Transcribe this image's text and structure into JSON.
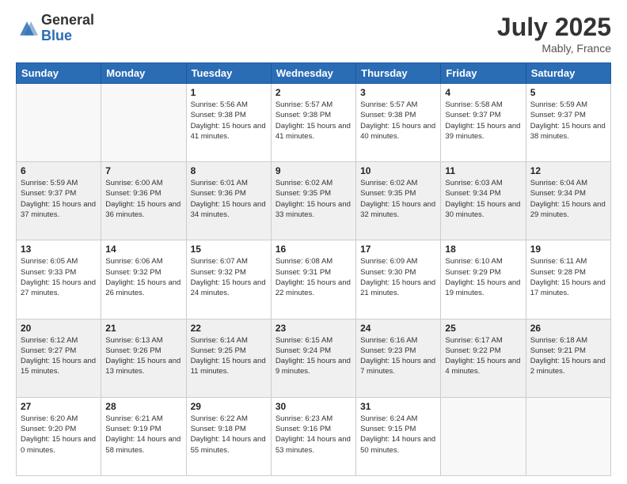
{
  "logo": {
    "general": "General",
    "blue": "Blue"
  },
  "title": {
    "month": "July 2025",
    "location": "Mably, France"
  },
  "days_of_week": [
    "Sunday",
    "Monday",
    "Tuesday",
    "Wednesday",
    "Thursday",
    "Friday",
    "Saturday"
  ],
  "weeks": [
    [
      {
        "day": "",
        "info": ""
      },
      {
        "day": "",
        "info": ""
      },
      {
        "day": "1",
        "info": "Sunrise: 5:56 AM\nSunset: 9:38 PM\nDaylight: 15 hours and 41 minutes."
      },
      {
        "day": "2",
        "info": "Sunrise: 5:57 AM\nSunset: 9:38 PM\nDaylight: 15 hours and 41 minutes."
      },
      {
        "day": "3",
        "info": "Sunrise: 5:57 AM\nSunset: 9:38 PM\nDaylight: 15 hours and 40 minutes."
      },
      {
        "day": "4",
        "info": "Sunrise: 5:58 AM\nSunset: 9:37 PM\nDaylight: 15 hours and 39 minutes."
      },
      {
        "day": "5",
        "info": "Sunrise: 5:59 AM\nSunset: 9:37 PM\nDaylight: 15 hours and 38 minutes."
      }
    ],
    [
      {
        "day": "6",
        "info": "Sunrise: 5:59 AM\nSunset: 9:37 PM\nDaylight: 15 hours and 37 minutes."
      },
      {
        "day": "7",
        "info": "Sunrise: 6:00 AM\nSunset: 9:36 PM\nDaylight: 15 hours and 36 minutes."
      },
      {
        "day": "8",
        "info": "Sunrise: 6:01 AM\nSunset: 9:36 PM\nDaylight: 15 hours and 34 minutes."
      },
      {
        "day": "9",
        "info": "Sunrise: 6:02 AM\nSunset: 9:35 PM\nDaylight: 15 hours and 33 minutes."
      },
      {
        "day": "10",
        "info": "Sunrise: 6:02 AM\nSunset: 9:35 PM\nDaylight: 15 hours and 32 minutes."
      },
      {
        "day": "11",
        "info": "Sunrise: 6:03 AM\nSunset: 9:34 PM\nDaylight: 15 hours and 30 minutes."
      },
      {
        "day": "12",
        "info": "Sunrise: 6:04 AM\nSunset: 9:34 PM\nDaylight: 15 hours and 29 minutes."
      }
    ],
    [
      {
        "day": "13",
        "info": "Sunrise: 6:05 AM\nSunset: 9:33 PM\nDaylight: 15 hours and 27 minutes."
      },
      {
        "day": "14",
        "info": "Sunrise: 6:06 AM\nSunset: 9:32 PM\nDaylight: 15 hours and 26 minutes."
      },
      {
        "day": "15",
        "info": "Sunrise: 6:07 AM\nSunset: 9:32 PM\nDaylight: 15 hours and 24 minutes."
      },
      {
        "day": "16",
        "info": "Sunrise: 6:08 AM\nSunset: 9:31 PM\nDaylight: 15 hours and 22 minutes."
      },
      {
        "day": "17",
        "info": "Sunrise: 6:09 AM\nSunset: 9:30 PM\nDaylight: 15 hours and 21 minutes."
      },
      {
        "day": "18",
        "info": "Sunrise: 6:10 AM\nSunset: 9:29 PM\nDaylight: 15 hours and 19 minutes."
      },
      {
        "day": "19",
        "info": "Sunrise: 6:11 AM\nSunset: 9:28 PM\nDaylight: 15 hours and 17 minutes."
      }
    ],
    [
      {
        "day": "20",
        "info": "Sunrise: 6:12 AM\nSunset: 9:27 PM\nDaylight: 15 hours and 15 minutes."
      },
      {
        "day": "21",
        "info": "Sunrise: 6:13 AM\nSunset: 9:26 PM\nDaylight: 15 hours and 13 minutes."
      },
      {
        "day": "22",
        "info": "Sunrise: 6:14 AM\nSunset: 9:25 PM\nDaylight: 15 hours and 11 minutes."
      },
      {
        "day": "23",
        "info": "Sunrise: 6:15 AM\nSunset: 9:24 PM\nDaylight: 15 hours and 9 minutes."
      },
      {
        "day": "24",
        "info": "Sunrise: 6:16 AM\nSunset: 9:23 PM\nDaylight: 15 hours and 7 minutes."
      },
      {
        "day": "25",
        "info": "Sunrise: 6:17 AM\nSunset: 9:22 PM\nDaylight: 15 hours and 4 minutes."
      },
      {
        "day": "26",
        "info": "Sunrise: 6:18 AM\nSunset: 9:21 PM\nDaylight: 15 hours and 2 minutes."
      }
    ],
    [
      {
        "day": "27",
        "info": "Sunrise: 6:20 AM\nSunset: 9:20 PM\nDaylight: 15 hours and 0 minutes."
      },
      {
        "day": "28",
        "info": "Sunrise: 6:21 AM\nSunset: 9:19 PM\nDaylight: 14 hours and 58 minutes."
      },
      {
        "day": "29",
        "info": "Sunrise: 6:22 AM\nSunset: 9:18 PM\nDaylight: 14 hours and 55 minutes."
      },
      {
        "day": "30",
        "info": "Sunrise: 6:23 AM\nSunset: 9:16 PM\nDaylight: 14 hours and 53 minutes."
      },
      {
        "day": "31",
        "info": "Sunrise: 6:24 AM\nSunset: 9:15 PM\nDaylight: 14 hours and 50 minutes."
      },
      {
        "day": "",
        "info": ""
      },
      {
        "day": "",
        "info": ""
      }
    ]
  ]
}
